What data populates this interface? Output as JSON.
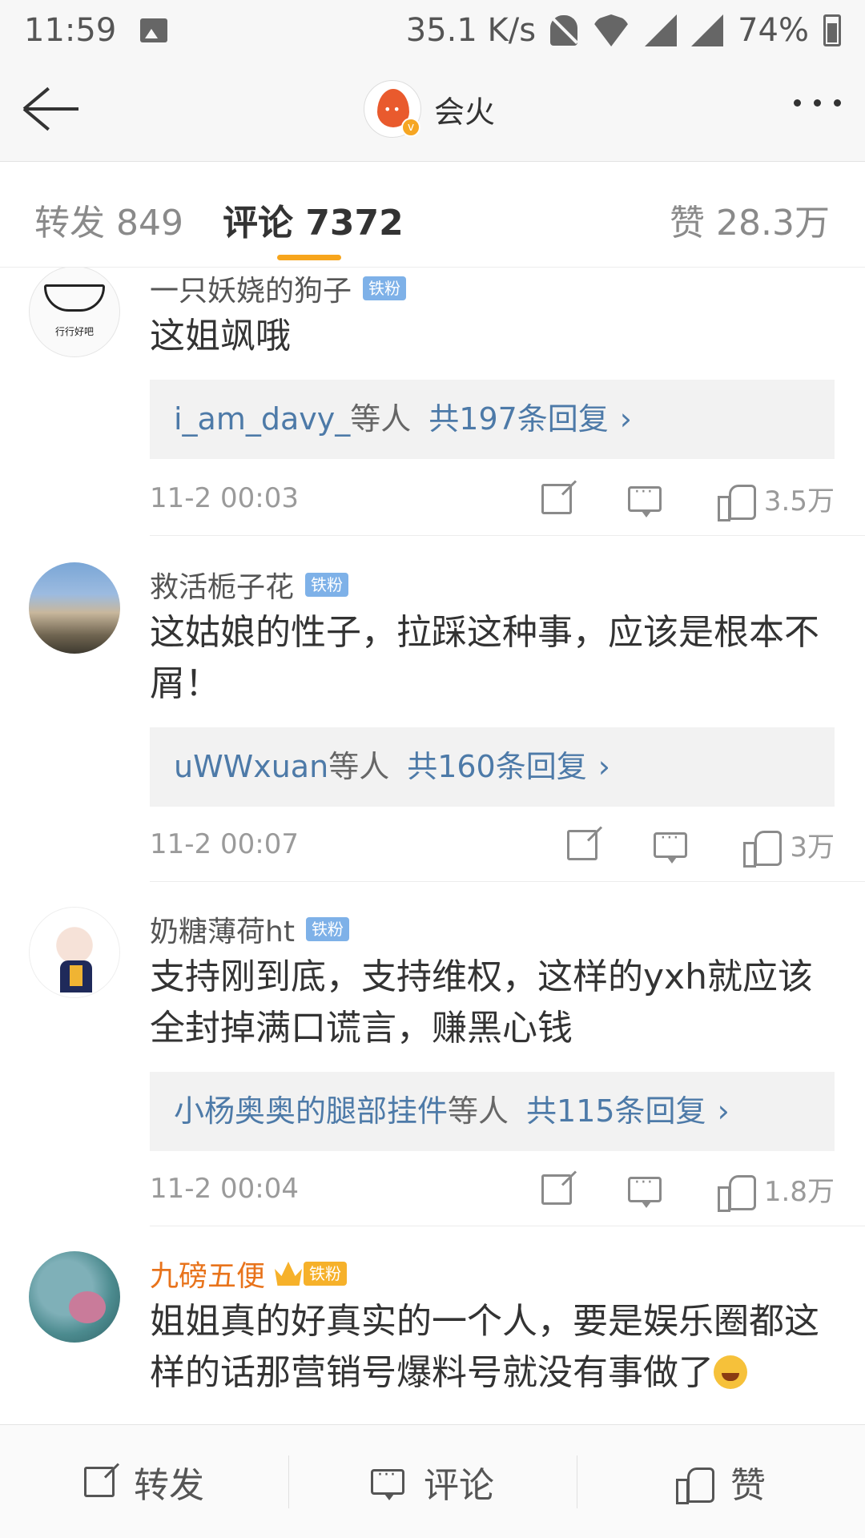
{
  "status_bar": {
    "time": "11:59",
    "speed": "35.1 K/s",
    "battery": "74%"
  },
  "header": {
    "name": "会火"
  },
  "tabs": {
    "repost": "转发 849",
    "comment": "评论 7372",
    "like": "赞 28.3万"
  },
  "comments": [
    {
      "username": "一只妖娆的狗子",
      "badge": "铁粉",
      "avatar_text": "行行好吧",
      "content": "这姐飒哦",
      "reply_names": "i_am_davy_",
      "reply_etc": "等人",
      "reply_count": "共197条回复",
      "chevron": "›",
      "time": "11-2 00:03",
      "likes": "3.5万"
    },
    {
      "username": "救活栀子花",
      "badge": "铁粉",
      "content": "这姑娘的性子，拉踩这种事，应该是根本不屑！",
      "reply_names": "uWWxuan",
      "reply_etc": "等人",
      "reply_count": "共160条回复",
      "chevron": "›",
      "time": "11-2 00:07",
      "likes": "3万"
    },
    {
      "username": "奶糖薄荷ht",
      "badge": "铁粉",
      "content": "支持刚到底，支持维权，这样的yxh就应该全封掉满口谎言，赚黑心钱",
      "reply_names": "小杨奥奥的腿部挂件",
      "reply_etc": "等人",
      "reply_count": "共115条回复",
      "chevron": "›",
      "time": "11-2 00:04",
      "likes": "1.8万"
    },
    {
      "username": "九磅五便",
      "badge": "铁粉",
      "content": "姐姐真的好真实的一个人，要是娱乐圈都这样的话那营销号爆料号就没有事做了"
    }
  ],
  "bottom_bar": {
    "repost": "转发",
    "comment": "评论",
    "like": "赞"
  },
  "colors": {
    "accent": "#f7a51c",
    "link": "#4d7aa8",
    "gold_user": "#e8731b",
    "badge_blue": "#7eb1e8"
  }
}
